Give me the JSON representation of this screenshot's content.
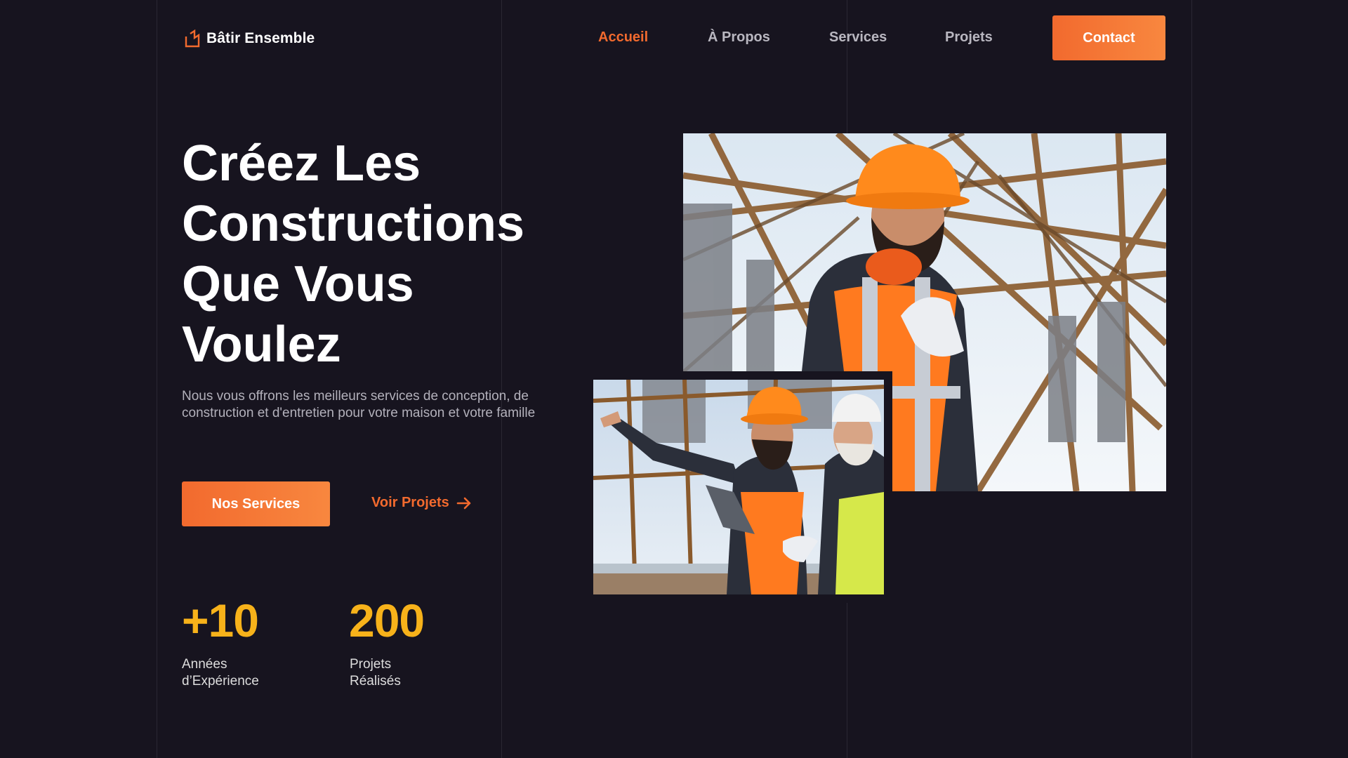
{
  "brand": {
    "name": "Bâtir Ensemble",
    "icon": "house-outline-icon"
  },
  "nav": {
    "items": [
      {
        "label": "Accueil",
        "active": true
      },
      {
        "label": "À Propos",
        "active": false
      },
      {
        "label": "Services",
        "active": false
      },
      {
        "label": "Projets",
        "active": false
      }
    ],
    "contact_label": "Contact"
  },
  "hero": {
    "title_lines": [
      "Créez Les",
      "Constructions",
      "Que Vous",
      "Voulez"
    ],
    "description": "Nous vous offrons les meilleurs services de conception, de construction et d'entretien pour votre maison et votre famille",
    "primary_cta": "Nos Services",
    "secondary_cta": "Voir Projets",
    "secondary_icon": "arrow-right-icon"
  },
  "stats": [
    {
      "value": "+10",
      "label": "Années d’Expérience"
    },
    {
      "value": "200",
      "label": "Projets Réalisés"
    }
  ],
  "images": {
    "main": "construction-worker-hardhat-photo",
    "secondary": "workers-pointing-tablet-photo"
  },
  "colors": {
    "background": "#17141f",
    "accent": "#f26a2e",
    "stat": "#f7b21a",
    "muted_text": "#b3b1bb"
  }
}
